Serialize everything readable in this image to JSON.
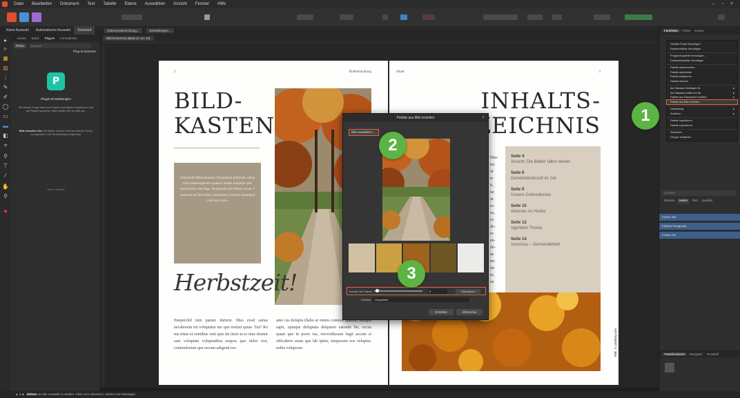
{
  "menubar": {
    "items": [
      "Datei",
      "Bearbeiten",
      "Dokument",
      "Text",
      "Tabelle",
      "Ebene",
      "Auswählen",
      "Ansicht",
      "Fenster",
      "Hilfe"
    ],
    "window_controls": "– ▫ ×"
  },
  "contextbar": {
    "tabs": [
      "Keine Auswahl",
      "Automatische Auswahl",
      "Standard"
    ],
    "fields": [
      "Dokumenteinrichtung…",
      "Einstellungen…"
    ]
  },
  "left_panel": {
    "tabs": [
      "Assets",
      "Stock",
      "Plug-In",
      "Formatierter"
    ],
    "button": "Photo",
    "search_placeholder": "Q Suche",
    "sort_label": "Plug-In beitreten",
    "plugin_title": "Plugin-Einstellungen",
    "text1": "Mit diesem Plugin kann man Farben aus Bildern extrahieren und als Palette speichern. Bitte wählen Sie ein Bild aus.",
    "text2_bold": "Bitte beachten Sie:",
    "text2": "Die Bilder werden nicht auf externe Server hochgeladen. Die Verarbeitung erfolgt lokal.",
    "link": "Mehr erfahren"
  },
  "document": {
    "tab_label": "Bild-Dokument.afpub (2 von 10)",
    "left_page": {
      "page_number": "2",
      "header": "Bildbetrachtung",
      "title_line1": "BILD-",
      "title_line2": "KASTEN",
      "quote": "Gemeinde Münchhausen Facepatum bullende. nibus ulias deatinegenum quamus modis empadis quis eariturantur rest fuga. Nonsucant alis dolori conse. F asserctes ad lab endus citaksitum voloreni arstunnun cum was rwen.",
      "script": "Herbstzeit!",
      "col1": "Eneperchil min parum durtern. Mus exed eatias necaborem int voluptatur mo que restisit quiae. Tur? Ro ma sitiae et ventibus vent quis im incto ta es inus elentur sam voluptate voluptatibus eequos quo dolor rest, commolorum que necum adigend ios-",
      "col2": "ame cus dolupta illabo ut omnis commis quatius, sumqui sapit, optaque doluptata delquisto eatende bit, occus quam que in porro ius, verovidiusum fugit accum si officabore arum que lab iptiur, temporum eos veluptur, nobis volupicae."
    },
    "right_page": {
      "header_left": "Inhalt",
      "page_number": "3",
      "title_line1": "INHALTS-",
      "title_line2": "ZEICHNIS",
      "partial_col": [
        "Mus",
        "tur",
        "ut",
        "te",
        "it,",
        "ue",
        "ut",
        "io-",
        "us,",
        "es",
        "de-",
        "re",
        "en-",
        "do-",
        "ae",
        "ne-",
        "im",
        "m,",
        "ue"
      ],
      "toc": [
        {
          "page": "Seite 4",
          "text": "Ansicht: Die Blätter fallen wieder"
        },
        {
          "page": "Seite 6",
          "text": "Gemeinderatszeit im Juli"
        },
        {
          "page": "Seite 9",
          "text": "Unsere Gottesdienste"
        },
        {
          "page": "Seite 10",
          "text": "Aktionen im Herbst"
        },
        {
          "page": "Seite 12",
          "text": "Irgendein Thema"
        },
        {
          "page": "Seite 14",
          "text": "Vorschau – Gemeindebrief"
        }
      ],
      "credit": "Bild: © pixabay.com"
    }
  },
  "dialog": {
    "title": "Palette aus Bild erstellen",
    "close": "×",
    "select_image": "Bild auswählen…",
    "swatches": [
      "#d1c1a2",
      "#caa042",
      "#a0631d",
      "#6e5624",
      "#ebebe9"
    ],
    "count_label": "Anzahl der Farben",
    "count_value": "5",
    "count_button": "Generieren",
    "position_label": "Position",
    "position_value": "Doppeltest",
    "create_button": "Erstellen",
    "cancel_button": "Abbrechen"
  },
  "right_panel": {
    "tabs": [
      "Farbfelder",
      "Farbe",
      "Kontur"
    ],
    "context_menu": [
      "Globale Farbe hinzufügen",
      "Rasterverläufe hinzufügen",
      "---",
      "Programmpalette hinzufügen...",
      "Dokumentpalette hinzufügen",
      "---",
      "Palette umbenennen...",
      "Palette duplizieren",
      "Palette entsperren",
      "Palette löschen",
      "---",
      "Als Standard festlegen für",
      "Als Standard entfernen für",
      "Palette aus Dokument erstellen",
      "Palette aus Bild erstellen...",
      "---",
      "Darstellung",
      "Sortieren",
      "---",
      "Palette importieren",
      "Palette exportieren",
      "---",
      "Schließen",
      "Gruppe schließen"
    ],
    "highlighted_item": "Palette aus Bild erstellen...",
    "search_placeholder": "Q Suche",
    "subtabs": [
      "Ebenen",
      "Seiten",
      "Text",
      "Qualität"
    ],
    "list_rows": [
      "¶ [Kein Stil]",
      "¶ [Basis-Paragraph]",
      "¶ Basis Stil"
    ],
    "bottom_tabs": [
      "Transformieren",
      "Navigator",
      "Protokoll"
    ]
  },
  "statusbar": {
    "zoom": "▲ 5 ◈",
    "hint_bold": "Ziehen",
    "hint": "um die Auswahl zu ändern. Klick zum Aktivieren. Ziehen zum Bewegen."
  },
  "badges": [
    "1",
    "2",
    "3"
  ],
  "accent_color": "#e8643b",
  "badge_color": "#5bb443"
}
